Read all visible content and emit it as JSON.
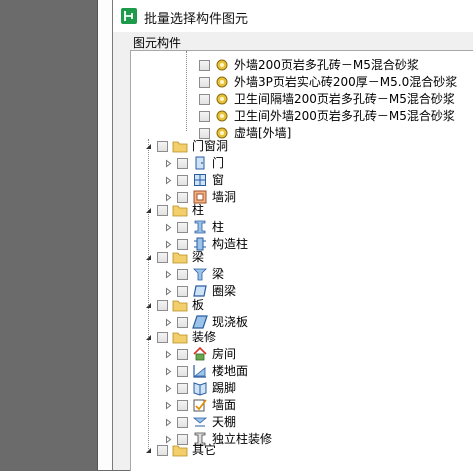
{
  "dialog": {
    "title": "批量选择构件图元",
    "group_label": "图元构件"
  },
  "tree": {
    "wall_items": [
      {
        "label": "外墙200页岩多孔砖－M5混合砂浆"
      },
      {
        "label": "外墙3P页岩实心砖200厚－M5.0混合砂浆"
      },
      {
        "label": "卫生间隔墙200页岩多孔砖－M5混合砂浆"
      },
      {
        "label": "卫生间外墙200页岩多孔砖－M5混合砂浆"
      },
      {
        "label": "虚墙[外墙]"
      }
    ],
    "door_window": {
      "label": "门窗洞",
      "children": [
        {
          "label": "门"
        },
        {
          "label": "窗"
        },
        {
          "label": "墙洞"
        }
      ]
    },
    "column": {
      "label": "柱",
      "children": [
        {
          "label": "柱"
        },
        {
          "label": "构造柱"
        }
      ]
    },
    "beam": {
      "label": "梁",
      "children": [
        {
          "label": "梁"
        },
        {
          "label": "圈梁"
        }
      ]
    },
    "slab": {
      "label": "板",
      "children": [
        {
          "label": "现浇板"
        }
      ]
    },
    "decoration": {
      "label": "装修",
      "children": [
        {
          "label": "房间"
        },
        {
          "label": "楼地面"
        },
        {
          "label": "踢脚"
        },
        {
          "label": "墙面"
        },
        {
          "label": "天棚"
        },
        {
          "label": "独立柱装修"
        }
      ]
    },
    "other": {
      "label": "其它"
    }
  }
}
